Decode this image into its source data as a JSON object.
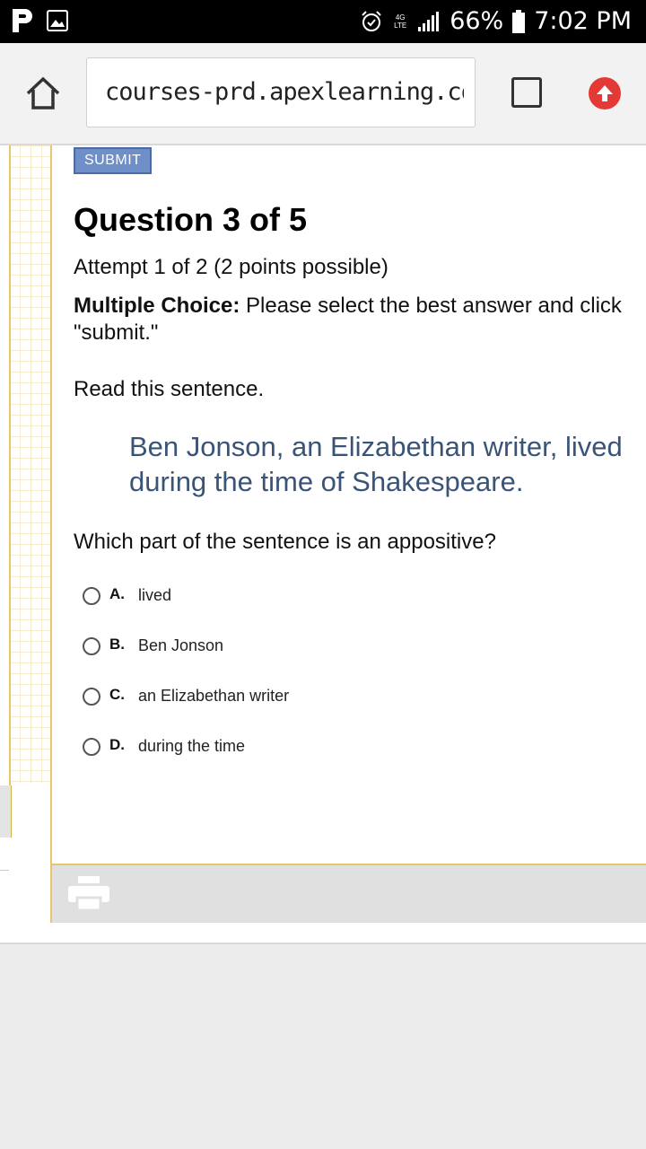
{
  "status_bar": {
    "network": "4G LTE",
    "battery": "66%",
    "time": "7:02 PM"
  },
  "browser": {
    "url": "courses-prd.apexlearning.com,"
  },
  "question": {
    "submit_label": "SUBMIT",
    "title": "Question 3 of 5",
    "attempt": "Attempt 1 of 2 (2 points possible)",
    "instruction_label": "Multiple Choice:",
    "instruction_text": " Please select the best answer and click \"submit.\"",
    "read_prompt": "Read this sentence.",
    "sentence": "Ben Jonson, an Elizabethan writer, lived during the time of Shakespeare.",
    "prompt": "Which part of the sentence is an appositive?",
    "options": [
      {
        "letter": "A.",
        "text": "lived"
      },
      {
        "letter": "B.",
        "text": "Ben Jonson"
      },
      {
        "letter": "C.",
        "text": "an Elizabethan writer"
      },
      {
        "letter": "D.",
        "text": "during the time"
      }
    ]
  },
  "colors": {
    "accent_border": "#e6c86a",
    "sentence_text": "#3a5478",
    "submit_bg": "#6f8fc9",
    "upload_red": "#e53935"
  }
}
